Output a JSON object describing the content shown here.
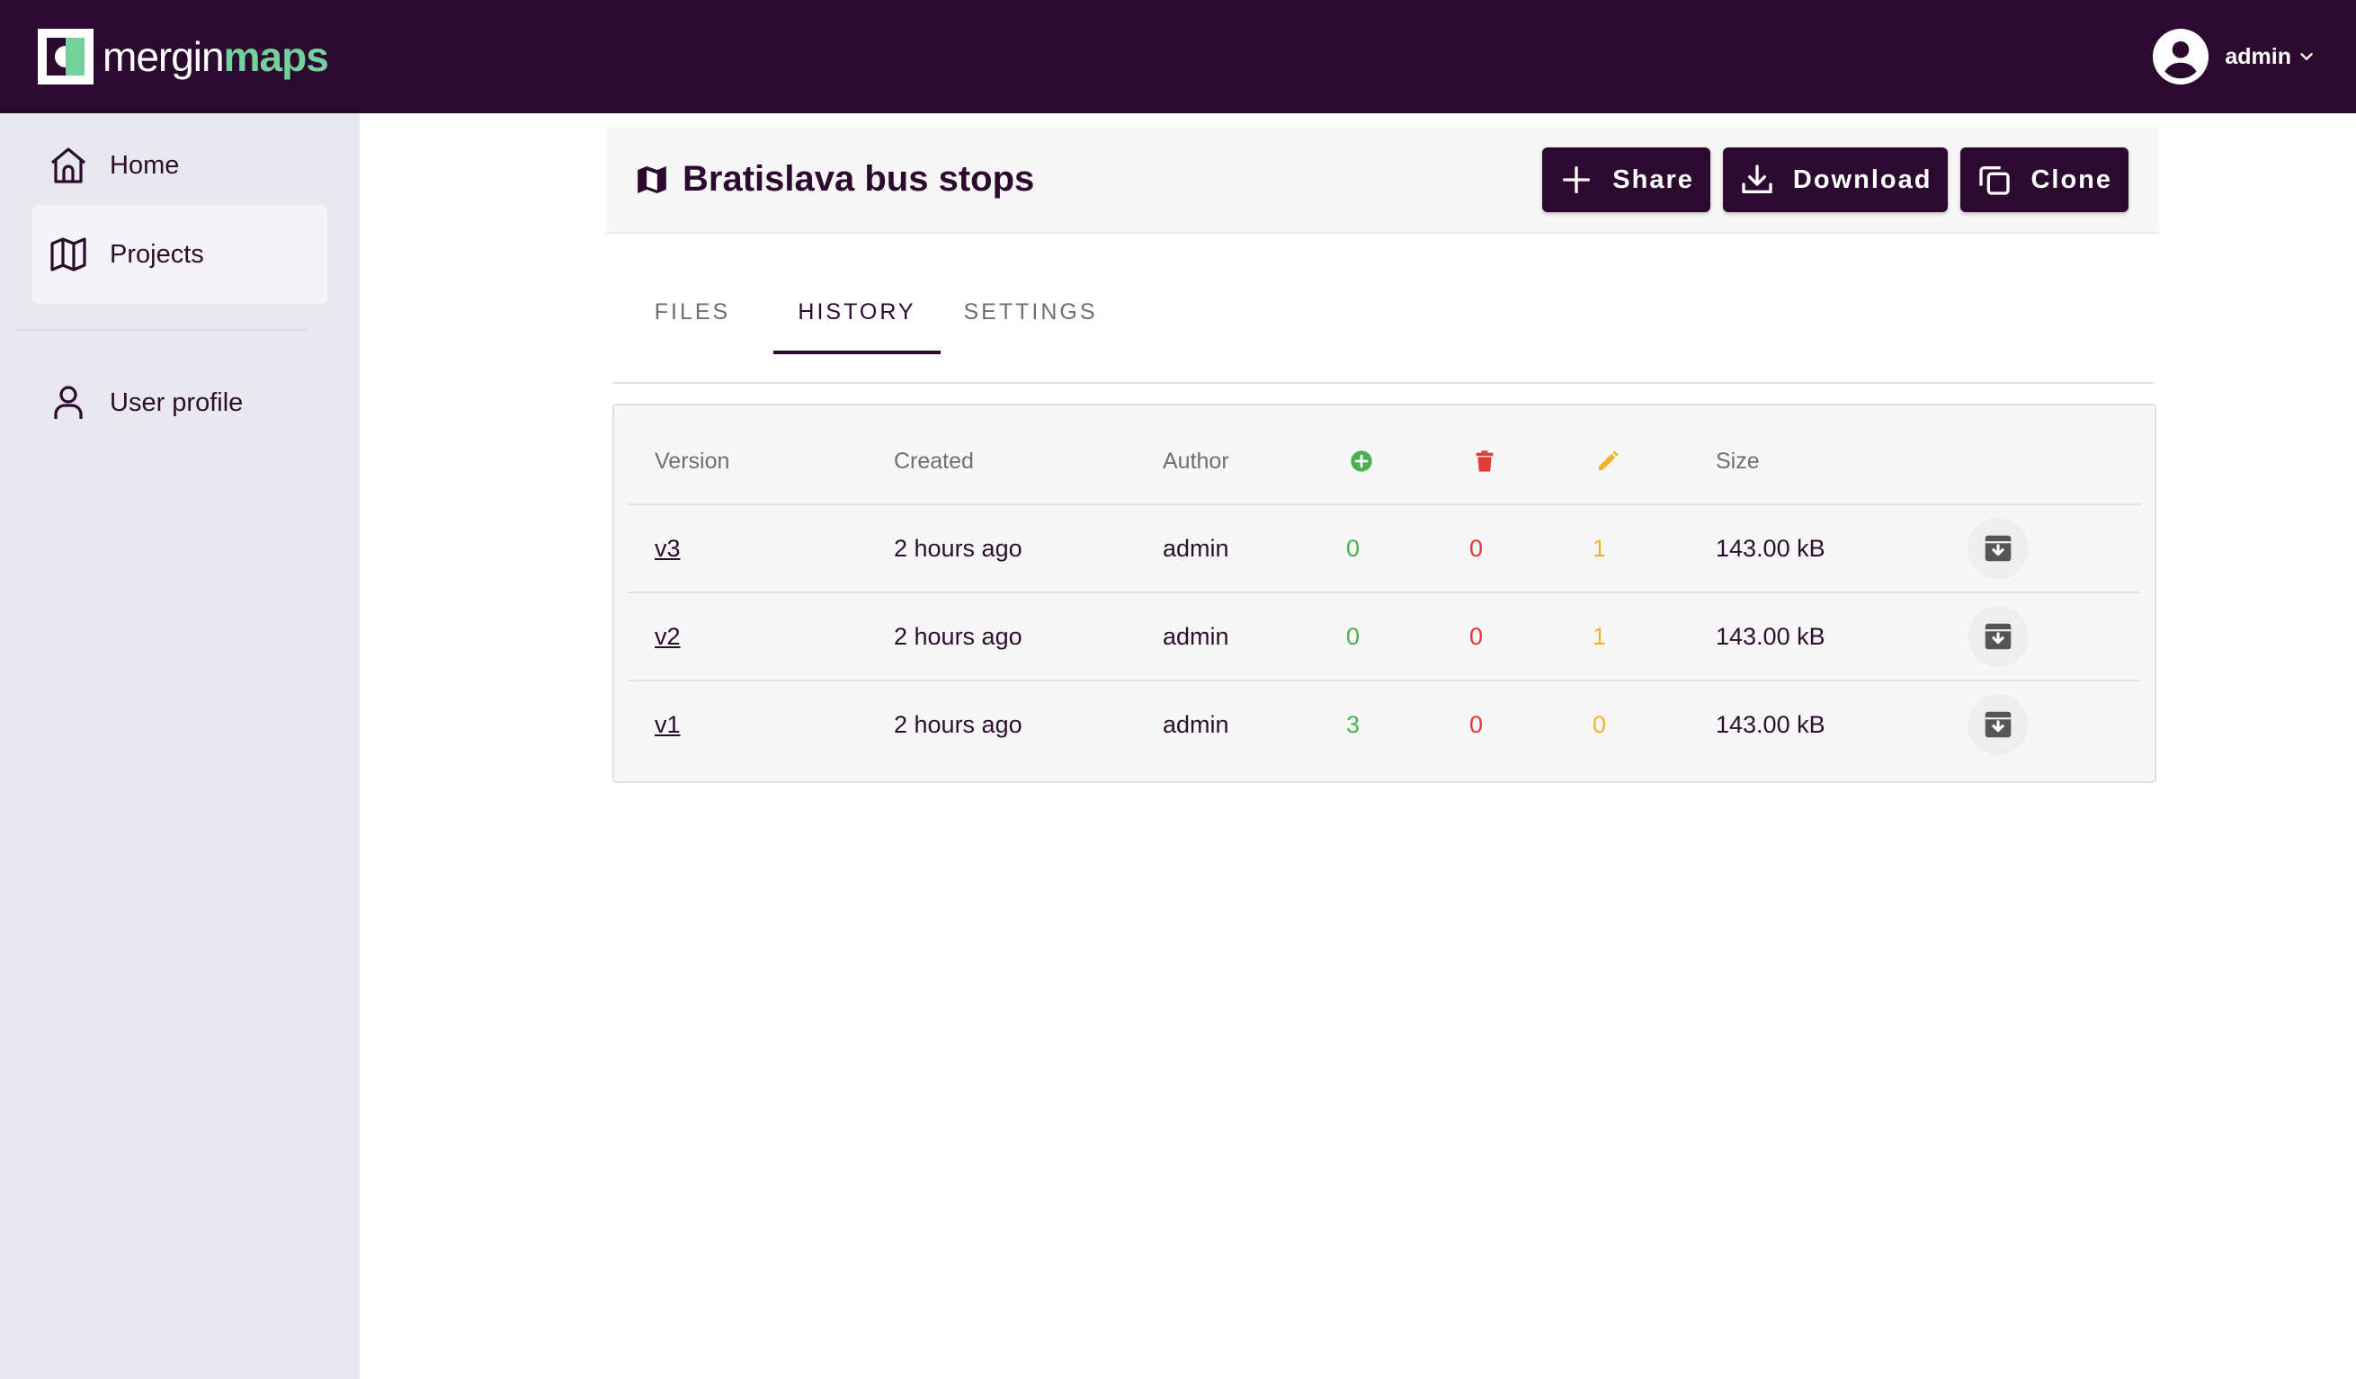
{
  "brand": {
    "logo_part1": "mergin",
    "logo_part2": "maps",
    "colors": {
      "topbar": "#2c0a2f",
      "accent": "#73d19c",
      "add": "#4caf50",
      "delete": "#e53935",
      "update": "#f0b429"
    }
  },
  "user_menu": {
    "username": "admin",
    "icon": "account-circle-icon"
  },
  "sidebar": {
    "items": [
      {
        "label": "Home",
        "icon": "home-icon"
      },
      {
        "label": "Projects",
        "icon": "map-icon",
        "active": true
      },
      {
        "label": "User profile",
        "icon": "user-icon"
      }
    ]
  },
  "project": {
    "title": "Bratislava bus stops",
    "icon": "map-icon",
    "actions": [
      {
        "label": "Share",
        "icon": "plus-icon"
      },
      {
        "label": "Download",
        "icon": "download-icon"
      },
      {
        "label": "Clone",
        "icon": "copy-icon"
      }
    ]
  },
  "tabs": [
    {
      "label": "FILES",
      "active": false
    },
    {
      "label": "HISTORY",
      "active": true
    },
    {
      "label": "SETTINGS",
      "active": false
    }
  ],
  "history_table": {
    "headers": {
      "version": "Version",
      "created": "Created",
      "author": "Author",
      "added_icon": "added-icon",
      "deleted_icon": "delete-icon",
      "updated_icon": "edit-icon",
      "size": "Size"
    },
    "rows": [
      {
        "version": "v3",
        "created": "2 hours ago",
        "author": "admin",
        "added": "0",
        "deleted": "0",
        "updated": "1",
        "size": "143.00 kB"
      },
      {
        "version": "v2",
        "created": "2 hours ago",
        "author": "admin",
        "added": "0",
        "deleted": "0",
        "updated": "1",
        "size": "143.00 kB"
      },
      {
        "version": "v1",
        "created": "2 hours ago",
        "author": "admin",
        "added": "3",
        "deleted": "0",
        "updated": "0",
        "size": "143.00 kB"
      }
    ]
  }
}
